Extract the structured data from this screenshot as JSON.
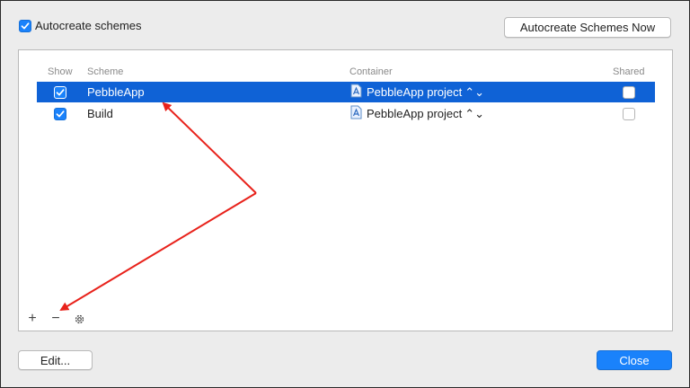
{
  "autocreate": {
    "label": "Autocreate schemes",
    "checked": true
  },
  "autocreate_now_button": "Autocreate Schemes Now",
  "table": {
    "columns": {
      "show": "Show",
      "scheme": "Scheme",
      "container": "Container",
      "shared": "Shared"
    },
    "rows": [
      {
        "show": true,
        "scheme": "PebbleApp",
        "container": "PebbleApp project",
        "shared": false,
        "selected": true
      },
      {
        "show": true,
        "scheme": "Build",
        "container": "PebbleApp project",
        "shared": false,
        "selected": false
      }
    ]
  },
  "tools": {
    "add": "+",
    "remove": "−"
  },
  "edit_button": "Edit...",
  "close_button": "Close",
  "colors": {
    "accent": "#1a82fb",
    "selection": "#0f62d6",
    "annotation_arrow": "#e8221b"
  },
  "icons": [
    "checkbox-icon",
    "xcode-project-icon",
    "popup-arrows-icon",
    "plus-icon",
    "minus-icon",
    "gear-icon"
  ]
}
